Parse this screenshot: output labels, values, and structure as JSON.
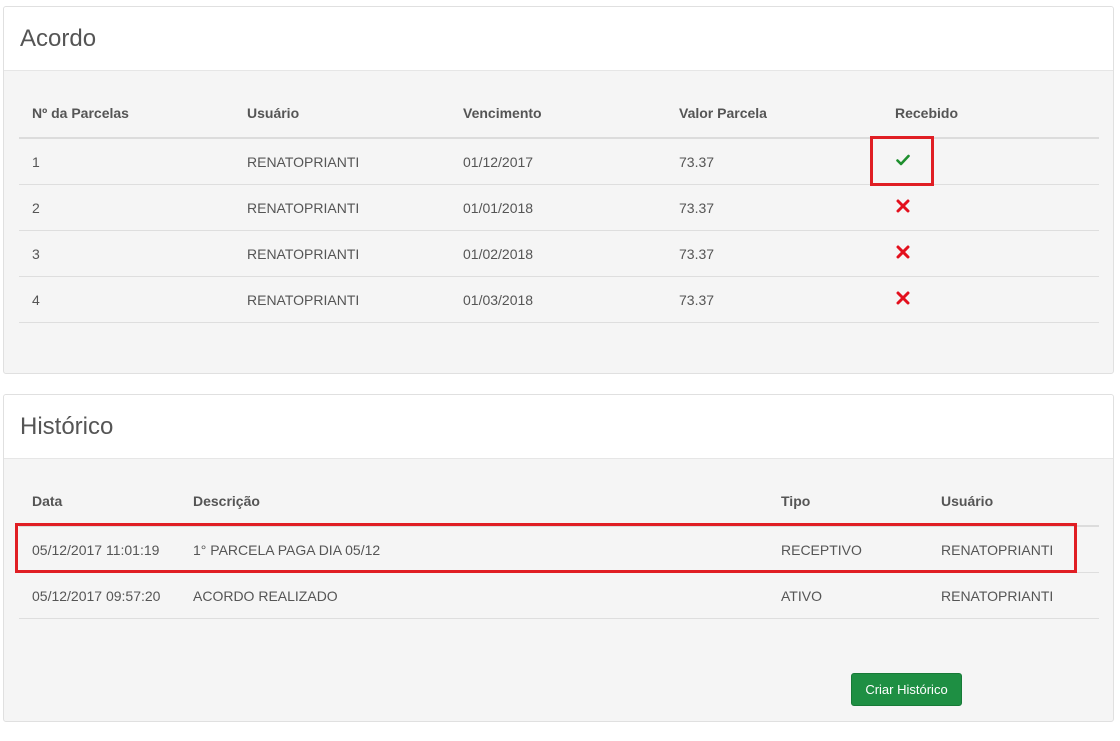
{
  "acordo": {
    "title": "Acordo",
    "columns": [
      "Nº da Parcelas",
      "Usuário",
      "Vencimento",
      "Valor Parcela",
      "Recebido"
    ],
    "rows": [
      {
        "parcela": "1",
        "usuario": "RENATOPRIANTI",
        "vencimento": "01/12/2017",
        "valor": "73.37",
        "recebido": "check-icon"
      },
      {
        "parcela": "2",
        "usuario": "RENATOPRIANTI",
        "vencimento": "01/01/2018",
        "valor": "73.37",
        "recebido": "cross-icon"
      },
      {
        "parcela": "3",
        "usuario": "RENATOPRIANTI",
        "vencimento": "01/02/2018",
        "valor": "73.37",
        "recebido": "cross-icon"
      },
      {
        "parcela": "4",
        "usuario": "RENATOPRIANTI",
        "vencimento": "01/03/2018",
        "valor": "73.37",
        "recebido": "cross-icon"
      }
    ]
  },
  "historico": {
    "title": "Histórico",
    "columns": [
      "Data",
      "Descrição",
      "Tipo",
      "Usuário"
    ],
    "rows": [
      {
        "data": "05/12/2017 11:01:19",
        "descricao": "1° PARCELA PAGA DIA 05/12",
        "tipo": "RECEPTIVO",
        "usuario": "RENATOPRIANTI"
      },
      {
        "data": "05/12/2017 09:57:20",
        "descricao": "ACORDO REALIZADO",
        "tipo": "ATIVO",
        "usuario": "RENATOPRIANTI"
      }
    ],
    "create_button_label": "Criar Histórico"
  },
  "colors": {
    "check": "#1e8f2e",
    "cross": "#e3101d",
    "highlight": "#e01e24",
    "button": "#1e8f43"
  }
}
